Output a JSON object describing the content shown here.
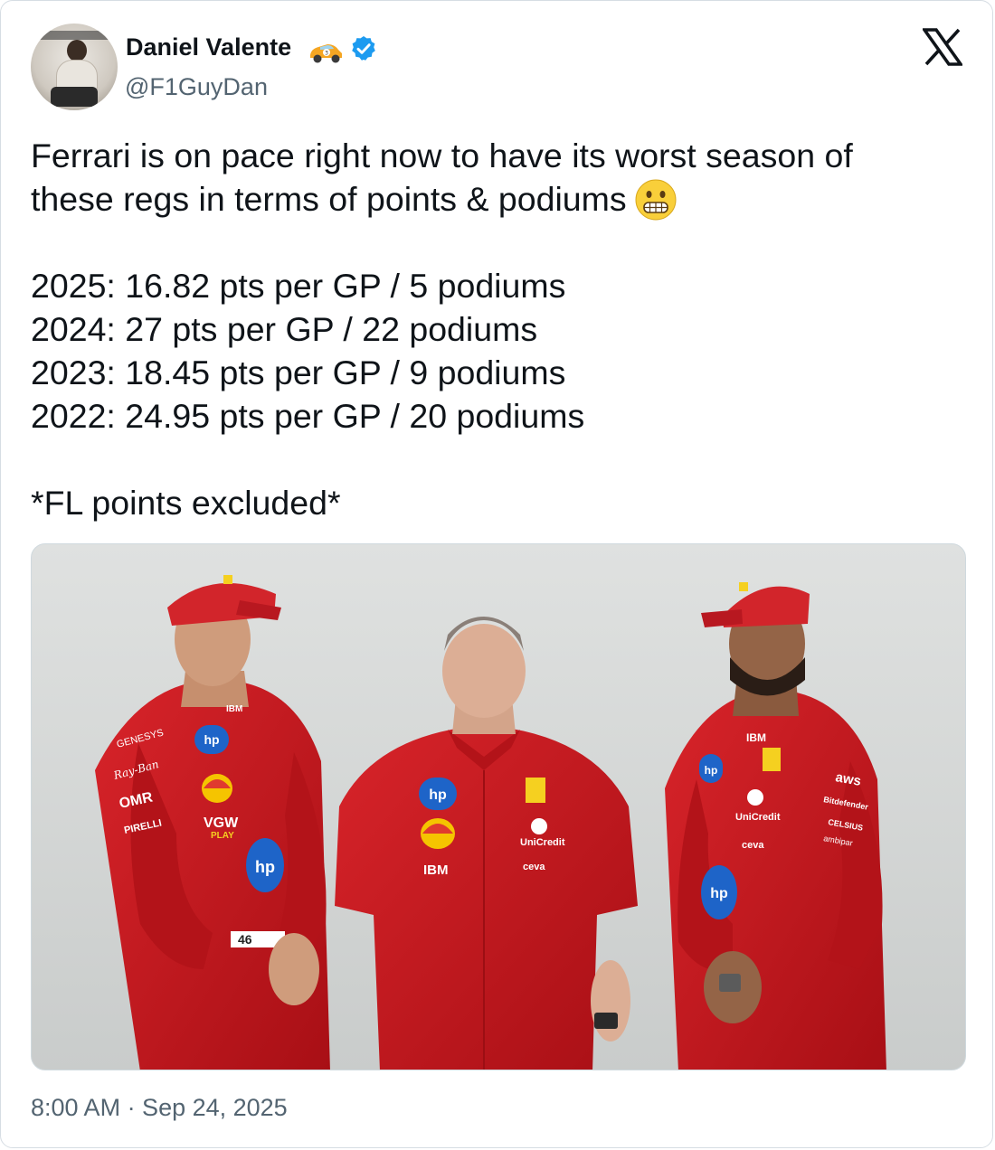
{
  "author": {
    "display_name": "Daniel Valente",
    "name_emoji": "racing-car-emoji",
    "verified": true,
    "handle": "@F1GuyDan",
    "avatar": "profile-photo"
  },
  "platform_logo": "x-logo",
  "tweet": {
    "lines": [
      "Ferrari is on pace right now to have its worst season of",
      "these regs in terms of points & podiums",
      "",
      "2025: 16.82 pts per GP / 5 podiums",
      "2024: 27 pts per GP / 22 podiums",
      "2023: 18.45 pts per GP / 9 podiums",
      "2022: 24.95 pts per GP / 20 podiums",
      "",
      "*FL points excluded*"
    ],
    "line2_emoji": "grimacing-face-emoji"
  },
  "media": {
    "description": "photo",
    "visible_logos": [
      "hp",
      "Shell",
      "IBM",
      "UniCredit",
      "ceva",
      "VGW PLAY",
      "aws",
      "Bitdefender",
      "Ray-Ban",
      "PIRELLI",
      "GENESYS",
      "46"
    ]
  },
  "timestamp": "8:00 AM · Sep 24, 2025",
  "colors": {
    "text": "#0f1419",
    "secondary": "#536471",
    "verified": "#1d9bf0",
    "ferrari_red": "#c8161d",
    "border": "#cfd9de"
  }
}
